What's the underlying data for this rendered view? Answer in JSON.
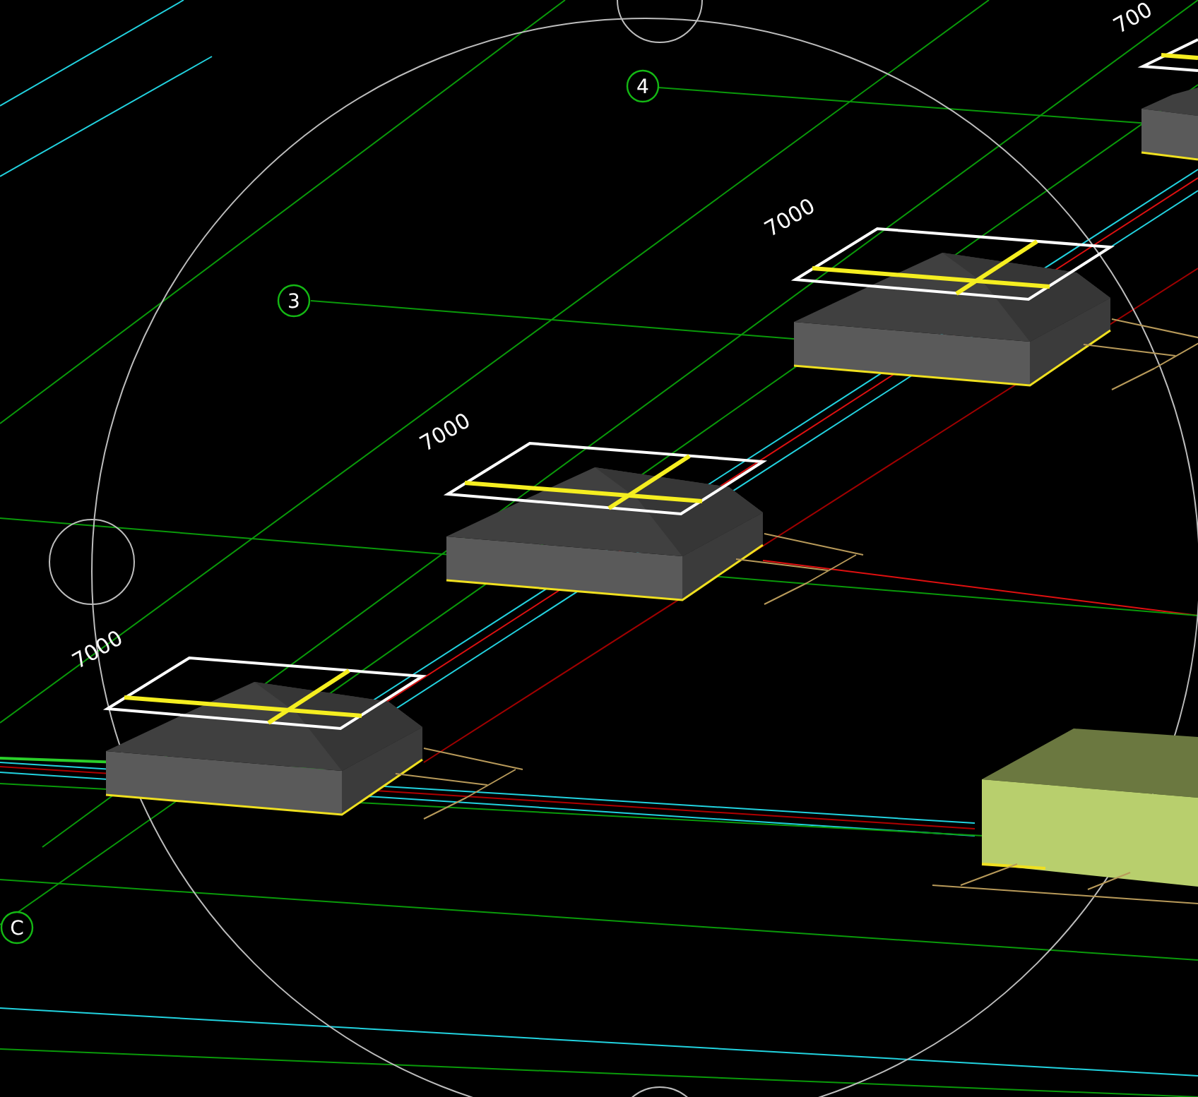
{
  "viewport": {
    "grid_bubbles": [
      {
        "label": "4"
      },
      {
        "label": "3"
      },
      {
        "label": "C"
      }
    ],
    "dimension_labels": [
      {
        "text": "700"
      },
      {
        "text": "7000"
      },
      {
        "text": "7000"
      },
      {
        "text": "7000"
      }
    ],
    "footings": [
      {
        "kind": "pedestal"
      },
      {
        "kind": "pedestal"
      },
      {
        "kind": "pedestal"
      },
      {
        "kind": "pedestal"
      },
      {
        "kind": "block"
      }
    ]
  }
}
